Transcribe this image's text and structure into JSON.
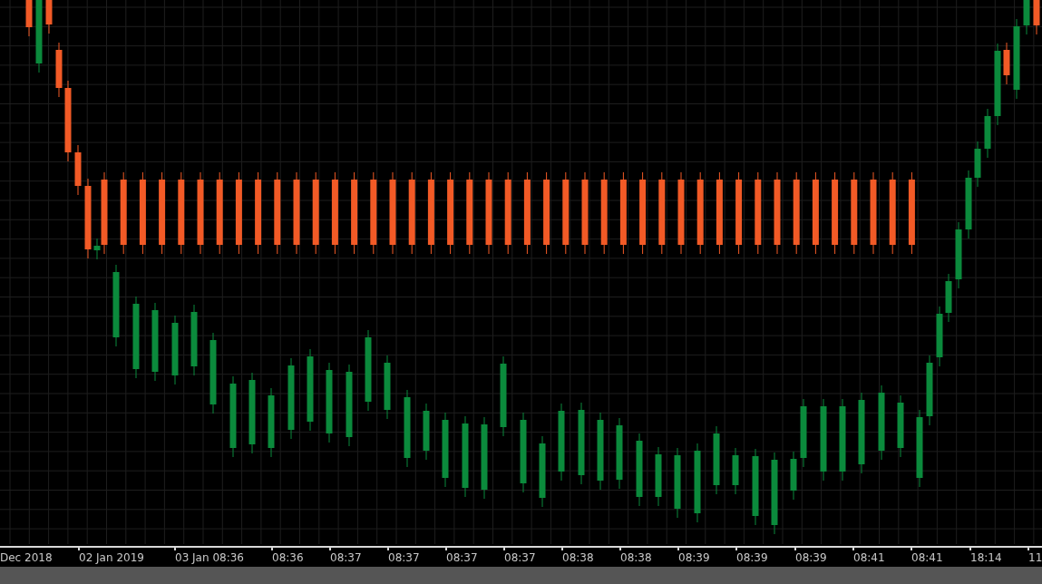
{
  "chart": {
    "x_axis_labels": [
      "Dec 2018",
      "02 Jan 2019",
      "03 Jan 08:36",
      "08:36",
      "08:37",
      "08:37",
      "08:37",
      "08:37",
      "08:38",
      "08:38",
      "08:39",
      "08:39",
      "08:39",
      "08:41",
      "08:41",
      "18:14",
      "11"
    ]
  }
}
